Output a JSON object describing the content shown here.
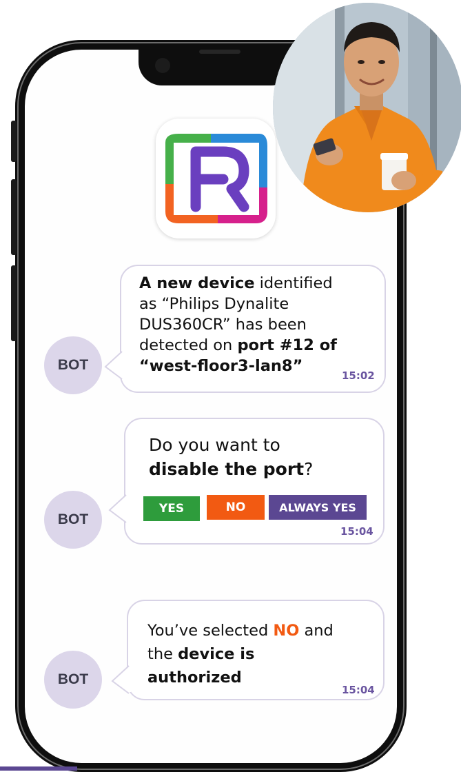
{
  "messages": [
    {
      "sender": "BOT",
      "time": "15:02",
      "lines": [
        [
          {
            "t": "A new device",
            "b": true
          },
          {
            "t": " identified",
            "b": false
          }
        ],
        [
          {
            "t": "as “Philips Dynalite",
            "b": false
          }
        ],
        [
          {
            "t": "DUS360CR” has been",
            "b": false
          }
        ],
        [
          {
            "t": "detected on ",
            "b": false
          },
          {
            "t": "port #12 of",
            "b": true
          }
        ],
        [
          {
            "t": "“west-floor3-lan8”",
            "b": true
          }
        ]
      ]
    },
    {
      "sender": "BOT",
      "time": "15:04",
      "lines": [
        [
          {
            "t": "Do you want to",
            "b": false
          }
        ],
        [
          {
            "t": "disable the port",
            "b": true
          },
          {
            "t": "?",
            "b": false
          }
        ]
      ],
      "buttons": {
        "yes": "YES",
        "no": "NO",
        "always": "ALWAYS YES"
      }
    },
    {
      "sender": "BOT",
      "time": "15:04",
      "lines": [
        [
          {
            "t": "You’ve selected ",
            "b": false
          },
          {
            "t": "NO",
            "b": true,
            "accent": true
          },
          {
            "t": " and",
            "b": false
          }
        ],
        [
          {
            "t": "the ",
            "b": false
          },
          {
            "t": "device is",
            "b": true
          }
        ],
        [
          {
            "t": "authorized",
            "b": true
          }
        ]
      ]
    }
  ],
  "colors": {
    "yes": "#2e9c3c",
    "no": "#f25a12",
    "always": "#5b4792",
    "timestamp": "#6a55a0",
    "avatar": "#dcd6ea",
    "bubble_border": "#d8d3e6"
  },
  "icons": {
    "app_icon": "app-logo-icon",
    "user_photo": "user-photo"
  }
}
